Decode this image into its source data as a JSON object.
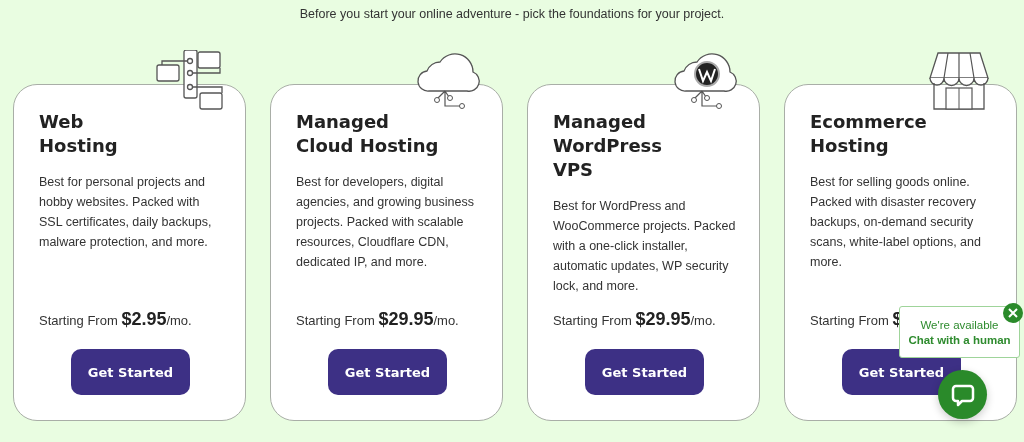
{
  "intro": "Before you start your online adventure - pick the foundations for your project.",
  "cards": [
    {
      "kind": "network",
      "title_lines": [
        "Web",
        "Hosting"
      ],
      "description": "Best for personal projects and hobby websites. Packed with SSL certificates, daily backups, malware protection, and more.",
      "price_label": "Starting From",
      "price": "$2.95",
      "period": "/mo.",
      "button": "Get Started"
    },
    {
      "kind": "cloud",
      "title_lines": [
        "Managed",
        "Cloud Hosting"
      ],
      "description": "Best for developers, digital agencies, and growing business projects. Packed with scalable resources, Cloudflare CDN, dedicated IP, and more.",
      "price_label": "Starting From",
      "price": "$29.95",
      "period": "/mo.",
      "button": "Get Started"
    },
    {
      "kind": "cloud-badge",
      "title_lines": [
        "Managed",
        "WordPress",
        "VPS"
      ],
      "description": "Best for WordPress and WooCommerce projects. Packed with a one-click installer, automatic updates, WP security lock, and more.",
      "price_label": "Starting From",
      "price": "$29.95",
      "period": "/mo.",
      "button": "Get Started"
    },
    {
      "kind": "store",
      "title_lines": [
        "Ecommerce",
        "Hosting"
      ],
      "description": "Best for selling goods online. Packed with disaster recovery backups, on-demand security scans, white-label options, and more.",
      "price_label": "Starting From",
      "price": "$",
      "button": "Get Started"
    }
  ],
  "chat": {
    "status": "We're available",
    "prompt": "Chat with a human"
  }
}
